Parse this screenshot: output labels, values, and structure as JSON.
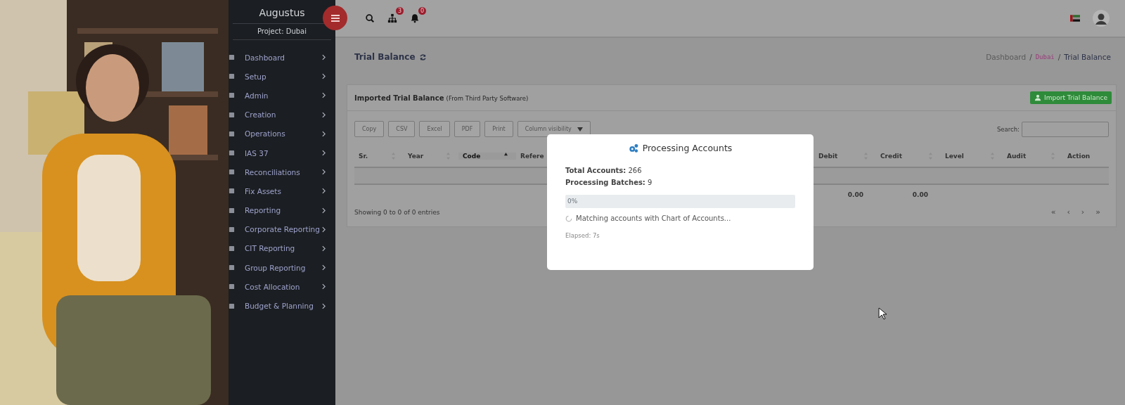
{
  "sidebar": {
    "brand": "Augustus",
    "project": "Project: Dubai",
    "items": [
      {
        "label": "Dashboard"
      },
      {
        "label": "Setup"
      },
      {
        "label": "Admin"
      },
      {
        "label": "Creation"
      },
      {
        "label": "Operations"
      },
      {
        "label": "IAS 37"
      },
      {
        "label": "Reconciliations"
      },
      {
        "label": "Fix Assets"
      },
      {
        "label": "Reporting"
      },
      {
        "label": "Corporate Reporting"
      },
      {
        "label": "CIT Reporting"
      },
      {
        "label": "Group Reporting"
      },
      {
        "label": "Cost Allocation"
      },
      {
        "label": "Budget & Planning"
      }
    ]
  },
  "topbar": {
    "notifications": [
      {
        "kind": "sitemap",
        "badge": "3"
      },
      {
        "kind": "bell",
        "badge": "0"
      }
    ]
  },
  "page": {
    "title": "Trial Balance",
    "breadcrumb": {
      "separator": "/",
      "items": [
        {
          "label": "Dashboard",
          "kind": "link"
        },
        {
          "label": "Dubai",
          "kind": "code"
        },
        {
          "label": "Trial Balance",
          "kind": "current"
        }
      ]
    }
  },
  "card": {
    "title": "Imported Trial Balance",
    "subtitle": "(From Third Party Software)",
    "import_button": "Import Trial Balance",
    "export_buttons": [
      {
        "label": "Copy",
        "kind": "plain"
      },
      {
        "label": "CSV",
        "kind": "plain"
      },
      {
        "label": "Excel",
        "kind": "plain"
      },
      {
        "label": "PDF",
        "kind": "plain"
      },
      {
        "label": "Print",
        "kind": "plain"
      },
      {
        "label": "Column visibility",
        "kind": "dropdown"
      }
    ],
    "search_label": "Search:",
    "table": {
      "columns": [
        {
          "label": "Sr.",
          "sortable": true,
          "sorted": false
        },
        {
          "label": "Year",
          "sortable": true,
          "sorted": false
        },
        {
          "label": "Code",
          "sortable": true,
          "sorted": true
        },
        {
          "label": "Refere",
          "sorted": false
        },
        {
          "label": "Debit",
          "sortable": true,
          "sorted": false,
          "total": "0.00"
        },
        {
          "label": "Credit",
          "sortable": true,
          "sorted": false,
          "total": "0.00"
        },
        {
          "label": "Level",
          "sortable": true,
          "sorted": false
        },
        {
          "label": "Audit",
          "sortable": true,
          "sorted": false
        },
        {
          "label": "Action",
          "sortable": false,
          "sorted": false
        }
      ]
    },
    "info": "Showing 0 to 0 of 0 entries",
    "pagination": [
      "«",
      "‹",
      "›",
      "»"
    ]
  },
  "modal": {
    "title": "Processing Accounts",
    "stats": [
      {
        "label": "Total Accounts:",
        "value": "266"
      },
      {
        "label": "Processing Batches:",
        "value": "9"
      }
    ],
    "progress": {
      "level": 0,
      "text": "0%"
    },
    "status": "Matching accounts with Chart of Accounts...",
    "elapsed": "Elapsed: 7s"
  }
}
